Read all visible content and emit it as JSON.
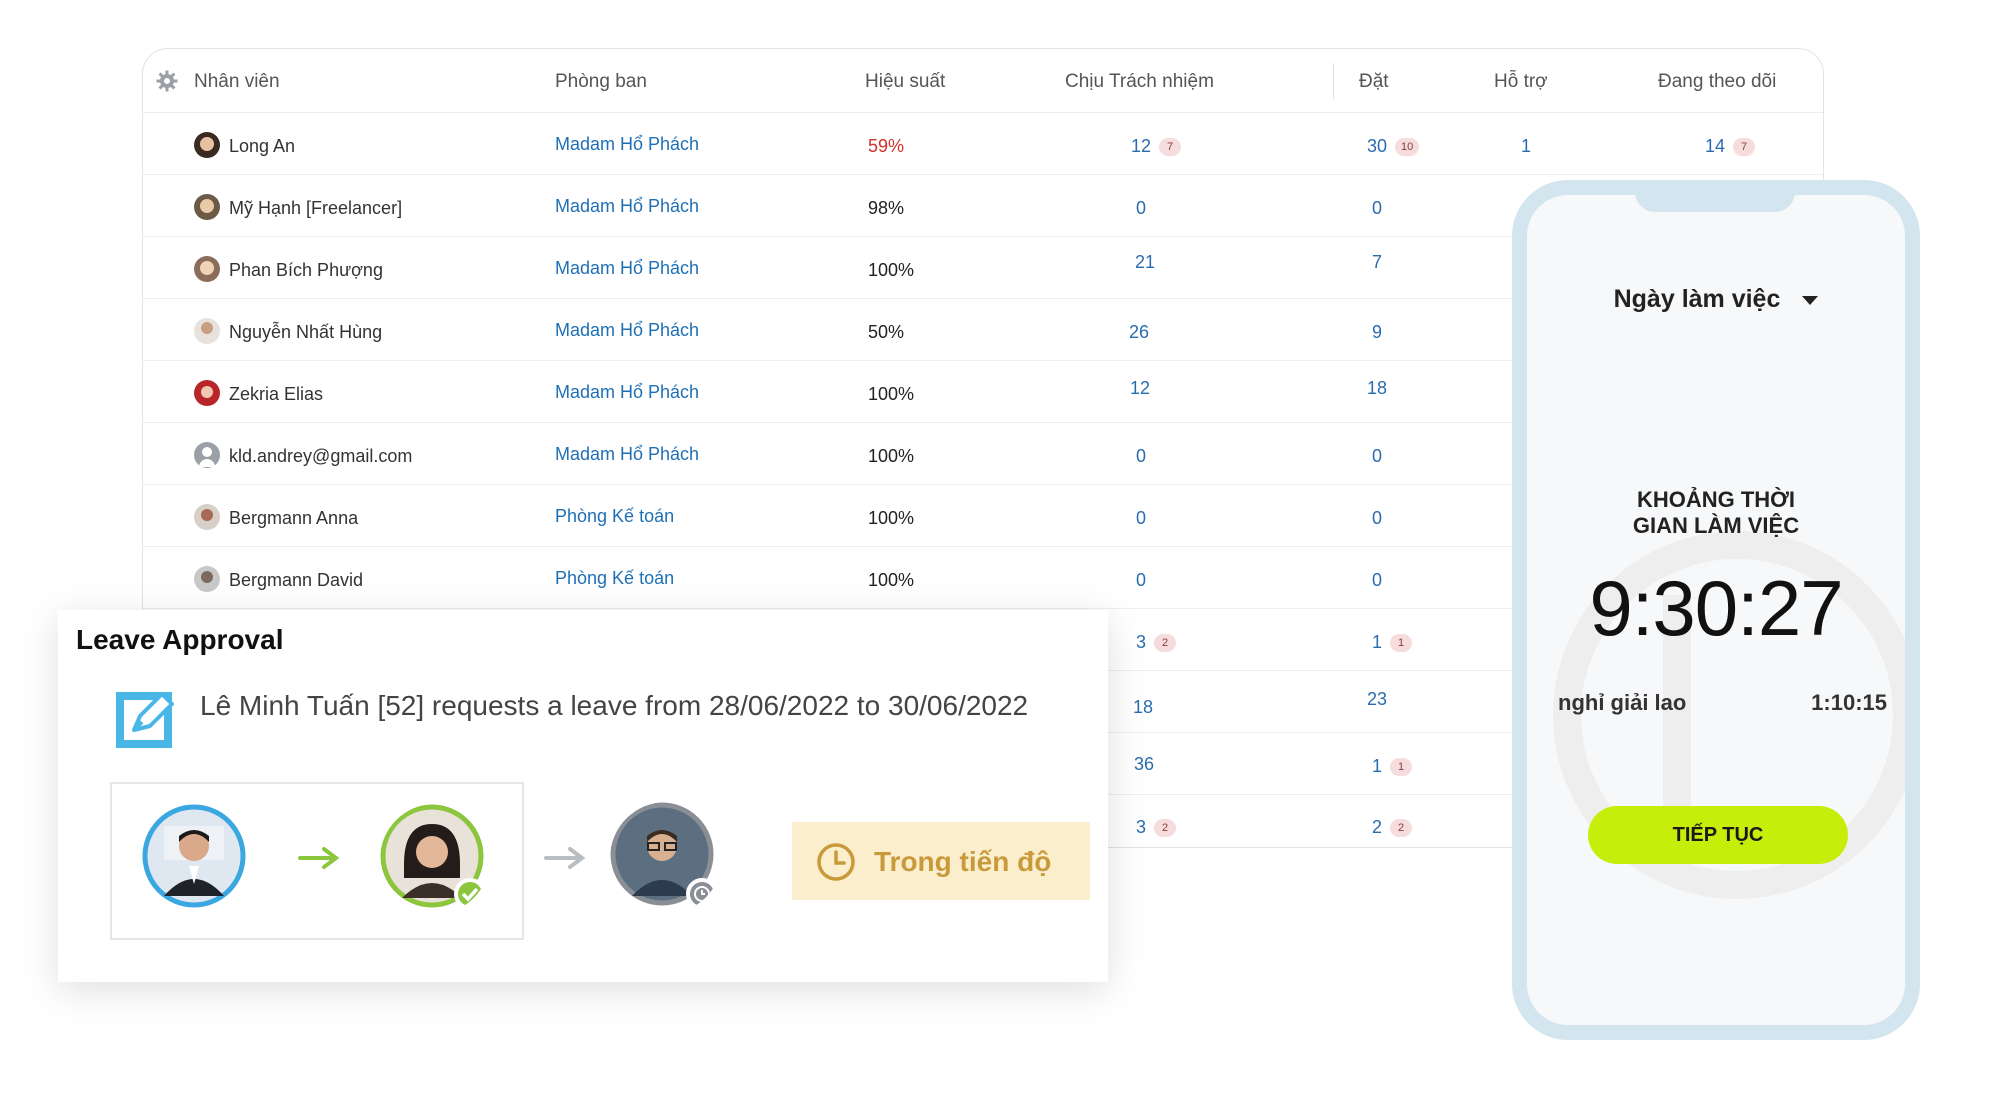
{
  "table": {
    "headers": {
      "employee": "Nhân viên",
      "department": "Phòng ban",
      "performance": "Hiệu suất",
      "responsible": "Chịu Trách nhiệm",
      "assigned": "Đặt",
      "support": "Hỗ trợ",
      "following": "Đang theo dõi"
    },
    "rows": [
      {
        "name": "Long An",
        "dept": "Madam Hổ Phách",
        "perf": "59%",
        "responsible": "12",
        "responsible_badge": "7",
        "assigned": "30",
        "assigned_badge": "10",
        "support": "1",
        "following": "14",
        "following_badge": "7"
      },
      {
        "name": "Mỹ Hạnh [Freelancer]",
        "dept": "Madam Hổ Phách",
        "perf": "98%",
        "responsible": "0",
        "assigned": "0"
      },
      {
        "name": "Phan Bích Phượng",
        "dept": "Madam Hổ Phách",
        "perf": "100%",
        "responsible": "21",
        "assigned": "7"
      },
      {
        "name": "Nguyễn Nhất Hùng",
        "dept": "Madam Hổ Phách",
        "perf": "50%",
        "responsible": "26",
        "assigned": "9"
      },
      {
        "name": "Zekria Elias",
        "dept": "Madam Hổ Phách",
        "perf": "100%",
        "responsible": "12",
        "assigned": "18"
      },
      {
        "name": "kld.andrey@gmail.com",
        "dept": "Madam Hổ Phách",
        "perf": "100%",
        "responsible": "0",
        "assigned": "0"
      },
      {
        "name": "Bergmann Anna",
        "dept": "Phòng Kế toán",
        "perf": "100%",
        "responsible": "0",
        "assigned": "0"
      },
      {
        "name": "Bergmann David",
        "dept": "Phòng Kế toán",
        "perf": "100%",
        "responsible": "0",
        "assigned": "0"
      },
      {
        "responsible": "3",
        "responsible_badge": "2",
        "assigned": "1",
        "assigned_badge": "1"
      },
      {
        "responsible": "18",
        "assigned": "23"
      },
      {
        "responsible": "36",
        "assigned": "1",
        "assigned_badge": "1"
      },
      {
        "responsible": "3",
        "responsible_badge": "2",
        "assigned": "2",
        "assigned_badge": "2"
      }
    ]
  },
  "leave": {
    "title": "Leave Approval",
    "message": "Lê Minh Tuấn [52] requests a leave from 28/06/2022 to 30/06/2022",
    "status": "Trong tiến độ"
  },
  "phone": {
    "workday_label": "Ngày làm việc",
    "duration_label_line1": "KHOẢNG THỜI",
    "duration_label_line2": "GIAN LÀM VIỆC",
    "timer": "9:30:27",
    "break_label": "nghỉ giải lao",
    "break_time": "1:10:15",
    "continue_label": "TIẾP TỤC"
  },
  "colors": {
    "link_blue": "#1f6fb5",
    "low_perf_red": "#d0312d",
    "accent_green": "#c7ee0b",
    "status_bg": "#fbeecd",
    "status_text": "#c99a3b",
    "approved_green": "#8cc63f",
    "pending_gray": "#8a8f96",
    "phone_frame": "#d3e6f0"
  }
}
